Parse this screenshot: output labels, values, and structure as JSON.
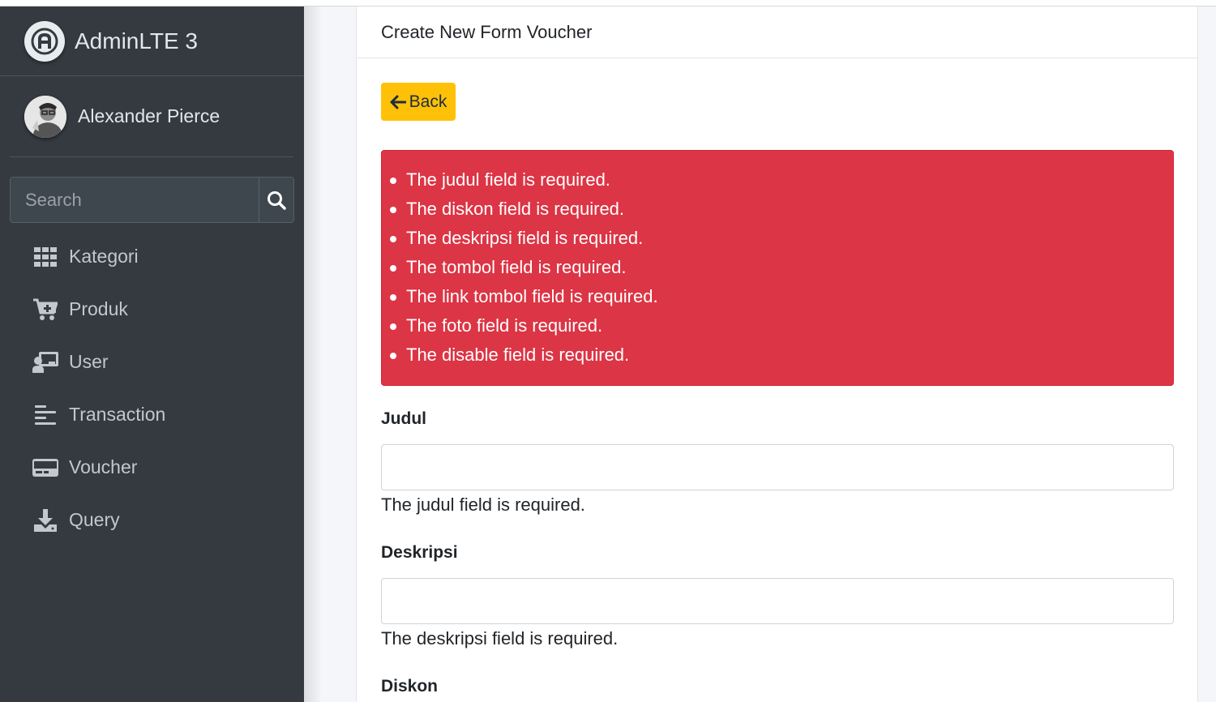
{
  "sidebar": {
    "brand": "AdminLTE 3",
    "user_name": "Alexander Pierce",
    "search_placeholder": "Search",
    "items": [
      {
        "label": "Kategori",
        "icon": "grid-icon"
      },
      {
        "label": "Produk",
        "icon": "cart-plus-icon"
      },
      {
        "label": "User",
        "icon": "chalkboard-user-icon"
      },
      {
        "label": "Transaction",
        "icon": "align-left-icon"
      },
      {
        "label": "Voucher",
        "icon": "credit-card-icon"
      },
      {
        "label": "Query",
        "icon": "download-icon"
      }
    ]
  },
  "card": {
    "title": "Create New Form Voucher",
    "back_label": "Back"
  },
  "alert": {
    "color": "#dc3545",
    "errors": [
      "The judul field is required.",
      "The diskon field is required.",
      "The deskripsi field is required.",
      "The tombol field is required.",
      "The link tombol field is required.",
      "The foto field is required.",
      "The disable field is required."
    ]
  },
  "form": {
    "judul": {
      "label": "Judul",
      "value": "",
      "error": "The judul field is required."
    },
    "deskripsi": {
      "label": "Deskripsi",
      "value": "",
      "error": "The deskripsi field is required."
    },
    "diskon": {
      "label": "Diskon"
    }
  },
  "colors": {
    "sidebar_bg": "#343a40",
    "warning": "#ffc107",
    "danger": "#dc3545"
  }
}
